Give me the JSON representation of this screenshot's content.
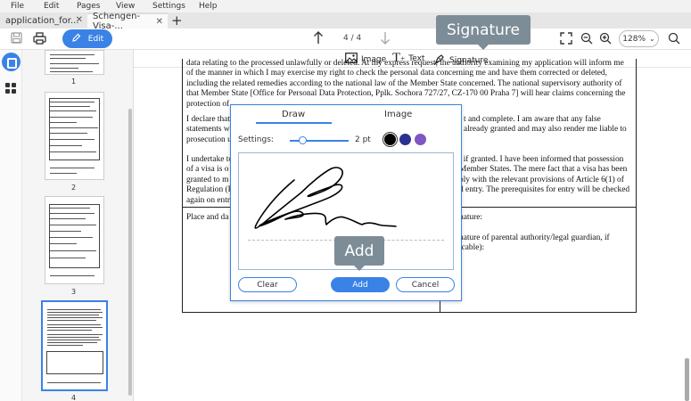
{
  "menu": [
    "File",
    "Edit",
    "Pages",
    "View",
    "Settings",
    "Help"
  ],
  "tabs": [
    {
      "label": "application_for...",
      "active": false
    },
    {
      "label": "Schengen-Visa-...",
      "active": true
    }
  ],
  "toolbar": {
    "edit_label": "Edit",
    "page_indicator": "4 / 4",
    "zoom": "128%"
  },
  "subtoolbar": {
    "image_label": "Image",
    "text_label": "Text",
    "signature_label": "Signature"
  },
  "thumbnails": [
    {
      "label": "1"
    },
    {
      "label": "2"
    },
    {
      "label": "3"
    },
    {
      "label": "4",
      "selected": true
    }
  ],
  "document": {
    "para1_lines": [
      "data relating to the processed unlawfully or deleted. At my express request, the authority examining my application will inform me",
      "of the manner in which I may exercise my right to check the personal data concerning me and have them corrected or deleted,",
      "including the related remedies according to the national law of the Member State concerned. The national supervisory authority of",
      "that Member State [Office for Personal Data Protection, Pplk. Sochora 727/27, CZ-170 00 Praha 7] will hear claims concerning the",
      "protection of"
    ],
    "para2_lines": [
      "I declare that",
      "statements w",
      "prosecution u"
    ],
    "para2_right_lines": [
      "t and complete. I am aware that any false",
      "already granted and may also render me liable to"
    ],
    "para3_lines": [
      "I undertake to",
      "of a visa is o",
      "granted to m",
      "Regulation (E",
      "again on entr"
    ],
    "para3_right_lines": [
      ", if granted. I have been informed that possession",
      "Member States. The mere fact that a visa has been",
      "ply with the relevant provisions of Article 6(1) of",
      "d entry. The prerequisites for entry will be checked"
    ],
    "place_label": "Place and da",
    "sig_right_lines": [
      "nature:",
      "",
      "nature of parental authority/legal guardian, if",
      "icable):"
    ]
  },
  "tooltips": {
    "signature": "Signature",
    "add": "Add"
  },
  "dialog": {
    "tab_draw": "Draw",
    "tab_image": "Image",
    "settings_label": "Settings:",
    "pt_label": "2 pt",
    "stroke_pt": 2,
    "colors": [
      "#000000",
      "#2b3190",
      "#7e57c2"
    ],
    "selected_color": "#000000",
    "clear_label": "Clear",
    "add_label": "Add",
    "cancel_label": "Cancel"
  },
  "colors": {
    "accent": "#3a82e6",
    "tooltip_bg": "#7d8d97"
  }
}
